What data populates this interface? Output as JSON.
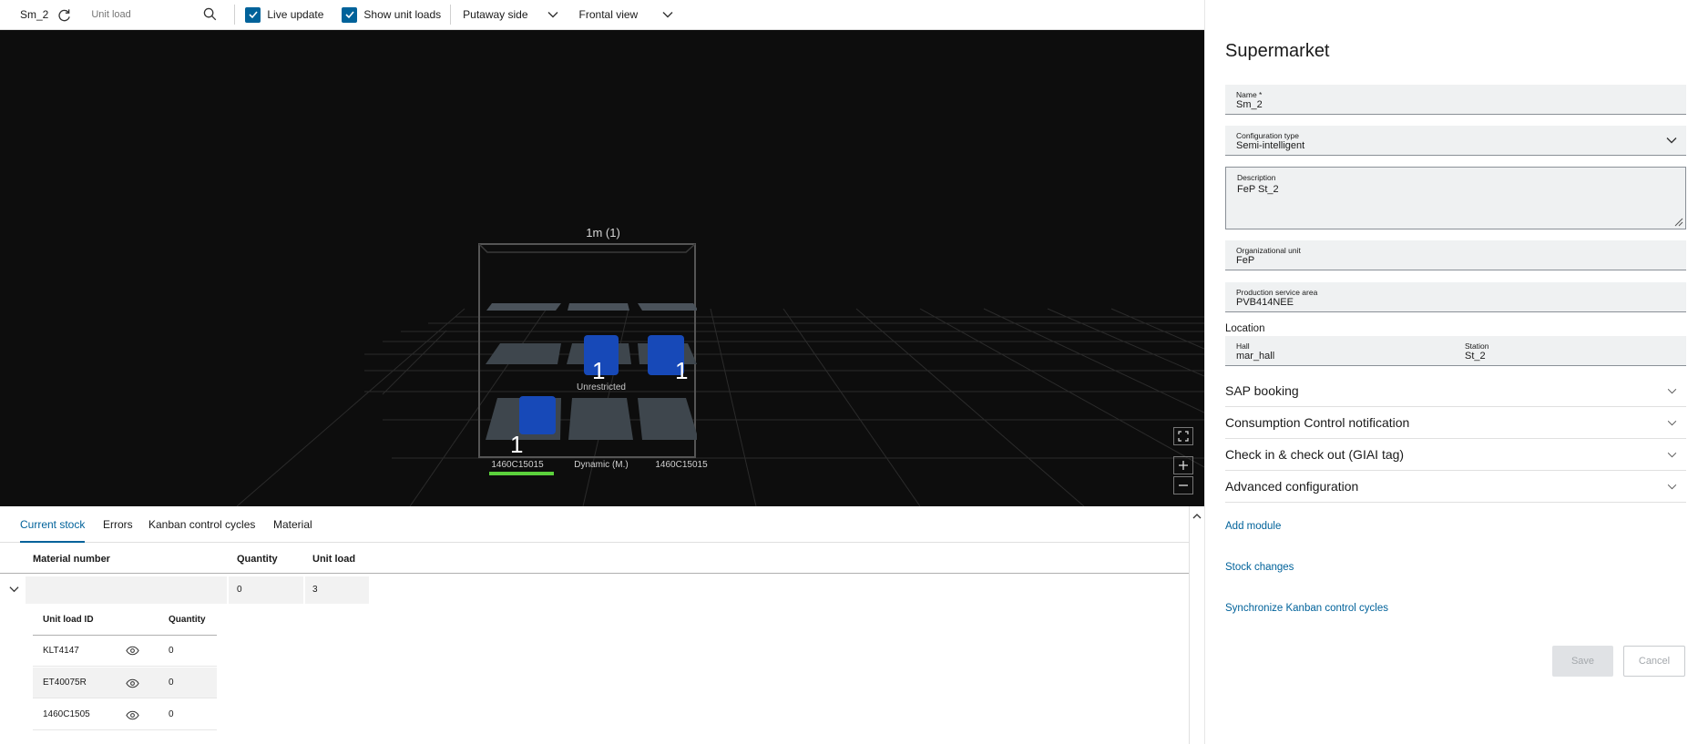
{
  "toolbar": {
    "supermarket_name": "Sm_2",
    "unit_load_placeholder": "Unit load",
    "live_update_label": "Live update",
    "show_unit_loads_label": "Show unit loads",
    "putaway_side_label": "Putaway side",
    "view_label": "Frontal view"
  },
  "viewport": {
    "module_title": "1m (1)",
    "stacks": [
      {
        "count": "1",
        "caption": "Unrestricted"
      },
      {
        "count": "1",
        "caption": ""
      },
      {
        "count": "1",
        "caption": ""
      }
    ],
    "bottom_labels": [
      "1460C15015",
      "Dynamic (M.)",
      "1460C15015"
    ]
  },
  "tabs": [
    "Current stock",
    "Errors",
    "Kanban control cycles",
    "Material"
  ],
  "stock_table": {
    "headers": {
      "material_number": "Material number",
      "quantity": "Quantity",
      "unit_load": "Unit load"
    },
    "group_row": {
      "material_number": "",
      "quantity": "0",
      "unit_load": "3"
    },
    "sub_headers": {
      "unit_load_id": "Unit load ID",
      "quantity": "Quantity"
    },
    "rows": [
      {
        "id": "KLT4147",
        "quantity": "0"
      },
      {
        "id": "ET40075R",
        "quantity": "0"
      },
      {
        "id": "1460C1505",
        "quantity": "0"
      }
    ]
  },
  "panel": {
    "title": "Supermarket",
    "name": {
      "label": "Name *",
      "value": "Sm_2"
    },
    "config_type": {
      "label": "Configuration type",
      "value": "Semi-intelligent"
    },
    "description": {
      "label": "Description",
      "value": "FeP St_2"
    },
    "org_unit": {
      "label": "Organizational unit",
      "value": "FeP"
    },
    "psa": {
      "label": "Production service area",
      "value": "PVB414NEE"
    },
    "location_title": "Location",
    "hall": {
      "label": "Hall",
      "value": "mar_hall"
    },
    "station": {
      "label": "Station",
      "value": "St_2"
    },
    "sections": [
      "SAP booking",
      "Consumption Control notification",
      "Check in & check out (GIAI tag)",
      "Advanced configuration"
    ],
    "links": [
      "Add module",
      "Stock changes",
      "Synchronize Kanban control cycles"
    ],
    "save_label": "Save",
    "cancel_label": "Cancel"
  },
  "colors": {
    "accent": "#00629a",
    "unit_load_blue": "#1749b8",
    "progress_green": "#5bd13c"
  }
}
